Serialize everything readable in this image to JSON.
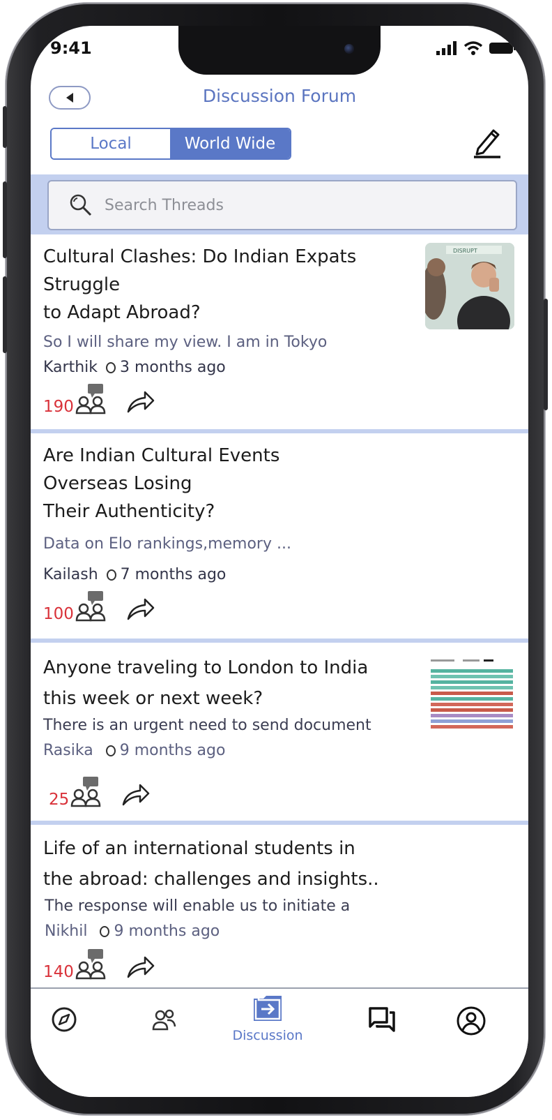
{
  "status": {
    "time": "9:41"
  },
  "header": {
    "title": "Discussion Forum",
    "back_icon": "chevron-left-icon",
    "compose_icon": "edit-pencil-icon"
  },
  "tabs": {
    "local": "Local",
    "world_wide": "World Wide",
    "selected": "World Wide"
  },
  "search": {
    "placeholder": "Search Threads"
  },
  "threads": [
    {
      "title_lines": [
        "Cultural Clashes: Do Indian Expats",
        "Struggle",
        "to Adapt Abroad?"
      ],
      "excerpt": "So I will share my view. I am in Tokyo",
      "author": "Karthik",
      "time": "3 months ago",
      "count": "190",
      "thumbnail": "photo"
    },
    {
      "title_lines": [
        "Are Indian Cultural Events",
        "Overseas Losing",
        "Their Authenticity?"
      ],
      "excerpt": "Data on Elo rankings,memory ...",
      "author": "Kailash",
      "time": "7 months ago",
      "count": "100",
      "thumbnail": "none"
    },
    {
      "title_lines": [
        "Anyone traveling to London to India",
        "this week or next week?"
      ],
      "excerpt": "There is an urgent need to send document",
      "author": "Rasika",
      "time": "9 months ago",
      "count": "25",
      "thumbnail": "chart"
    },
    {
      "title_lines": [
        "Life of an international students in",
        "the abroad: challenges and insights.."
      ],
      "excerpt": "The response will enable us to initiate a",
      "author": "Nikhil",
      "time": "9 months ago",
      "count": "140",
      "thumbnail": "none"
    }
  ],
  "nav": {
    "items": [
      {
        "icon": "compass-icon",
        "label": ""
      },
      {
        "icon": "people-icon",
        "label": ""
      },
      {
        "icon": "discussion-icon",
        "label": "Discussion",
        "active": true
      },
      {
        "icon": "chat-icon",
        "label": ""
      },
      {
        "icon": "profile-icon",
        "label": ""
      }
    ]
  },
  "colors": {
    "accent": "#5a78c7",
    "band": "#c3d0ef",
    "count": "#d9323a"
  }
}
